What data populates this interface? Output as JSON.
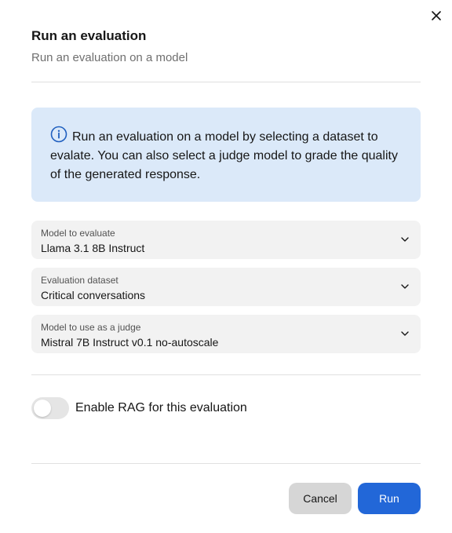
{
  "dialog": {
    "title": "Run an evaluation",
    "subtitle": "Run an evaluation on a model",
    "close_icon": "close-icon"
  },
  "info": {
    "icon": "info-icon",
    "text": "Run an evaluation on a model by selecting a dataset to evalate. You can also select a judge model to grade the quality of the generated response."
  },
  "fields": [
    {
      "label": "Model to evaluate",
      "value": "Llama 3.1 8B Instruct"
    },
    {
      "label": "Evaluation dataset",
      "value": "Critical conversations"
    },
    {
      "label": "Model to use as a judge",
      "value": "Mistral 7B Instruct v0.1 no-autoscale"
    }
  ],
  "rag_toggle": {
    "label": "Enable RAG for this evaluation",
    "enabled": false
  },
  "actions": {
    "cancel_label": "Cancel",
    "run_label": "Run"
  },
  "colors": {
    "info_bg": "#dbe9f9",
    "accent": "#2267d8",
    "info_icon": "#1f5fbf"
  }
}
